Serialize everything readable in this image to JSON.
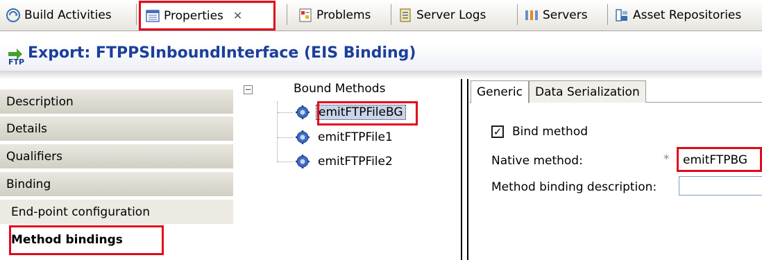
{
  "tabs": [
    {
      "label": "Build Activities",
      "icon": "build-activities-icon"
    },
    {
      "label": "Properties",
      "icon": "properties-icon",
      "active": true,
      "close": "✕"
    },
    {
      "label": "Problems",
      "icon": "problems-icon"
    },
    {
      "label": "Server Logs",
      "icon": "server-logs-icon"
    },
    {
      "label": "Servers",
      "icon": "servers-icon"
    },
    {
      "label": "Asset Repositories",
      "icon": "asset-repositories-icon"
    }
  ],
  "header": {
    "title": "Export: FTPPSInboundInterface (EIS Binding)",
    "icon": "ftp-export-icon"
  },
  "nav": {
    "items": [
      {
        "label": "Description"
      },
      {
        "label": "Details"
      },
      {
        "label": "Qualifiers"
      },
      {
        "label": "Binding"
      },
      {
        "label": "End-point configuration"
      },
      {
        "label": "Method bindings",
        "selected": true
      }
    ]
  },
  "tree": {
    "toggle": "−",
    "root": "Bound Methods",
    "items": [
      {
        "label": "emitFTPFileBG",
        "selected": true
      },
      {
        "label": "emitFTPFile1"
      },
      {
        "label": "emitFTPFile2"
      }
    ]
  },
  "detail": {
    "tabs": [
      "Generic",
      "Data Serialization"
    ],
    "bind_method_label": "Bind method",
    "bind_method_checked": true,
    "check_mark": "✓",
    "native_method_label": "Native method:",
    "required_marker": "*",
    "native_method_value": "emitFTPBG",
    "method_binding_description_label": "Method binding description:",
    "method_binding_description_value": ""
  },
  "colors": {
    "highlight": "#e4081b",
    "header_title": "#1c3f9c",
    "selection": "#c9d3e9"
  }
}
